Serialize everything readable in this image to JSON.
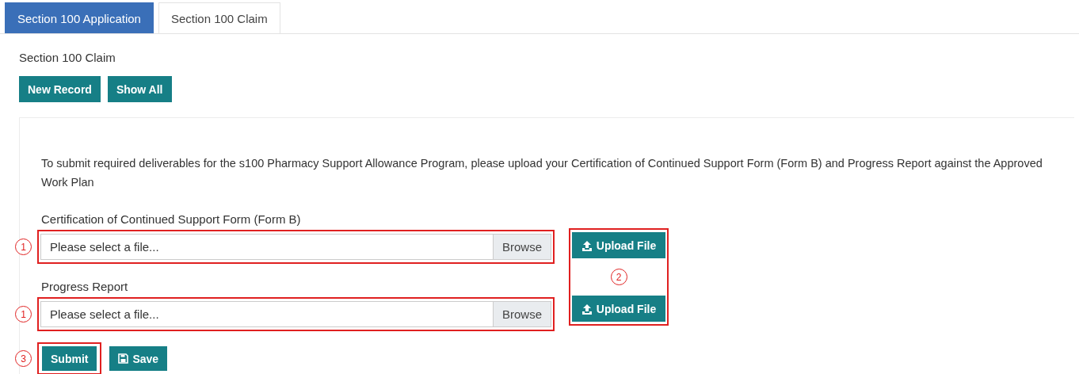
{
  "tabs": [
    {
      "label": "Section 100 Application",
      "selected": true
    },
    {
      "label": "Section 100 Claim",
      "selected": false
    }
  ],
  "heading": "Section 100 Claim",
  "toolbar": [
    "New Record",
    "Show All"
  ],
  "notice": "To submit required deliverables for the s100 Pharmacy Support Allowance Program, please upload your Certification of Continued Support Form (Form B) and Progress Report against the Approved Work Plan",
  "fields": [
    {
      "label": "Certification of Continued Support Form (Form B)",
      "placeholder": "Please select a file...",
      "browse": "Browse",
      "callout": "1",
      "upload": "Upload File"
    },
    {
      "label": "Progress Report",
      "placeholder": "Please select a file...",
      "browse": "Browse",
      "callout": "1",
      "upload": "Upload File"
    }
  ],
  "upload_callout": "2",
  "actions": [
    {
      "kind": "submit",
      "label": "Submit",
      "callout": "3"
    },
    {
      "kind": "save",
      "label": "Save"
    }
  ]
}
